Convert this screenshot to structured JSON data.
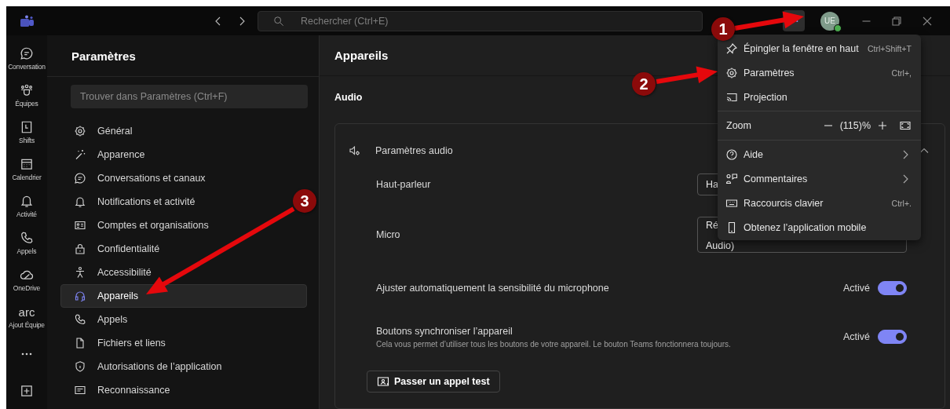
{
  "titlebar": {
    "search": {
      "placeholder": "Rechercher (Ctrl+E)"
    },
    "avatar": {
      "initials": "UE"
    }
  },
  "rail": [
    {
      "kind": "app",
      "label": "Conversation"
    },
    {
      "kind": "app",
      "label": "Équipes"
    },
    {
      "kind": "app",
      "label": "Shifts"
    },
    {
      "kind": "app",
      "label": "Calendrier"
    },
    {
      "kind": "app",
      "label": "Activité"
    },
    {
      "kind": "app",
      "label": "Appels"
    },
    {
      "kind": "app",
      "label": "OneDrive"
    },
    {
      "kind": "text",
      "mark": "arc",
      "label": "Ajout Équipe"
    },
    {
      "kind": "more"
    },
    {
      "kind": "add"
    }
  ],
  "settings": {
    "title": "Paramètres",
    "search": {
      "placeholder": "Trouver dans Paramètres (Ctrl+F)"
    },
    "items": [
      {
        "label": "Général",
        "selected": false
      },
      {
        "label": "Apparence",
        "selected": false
      },
      {
        "label": "Conversations et canaux",
        "selected": false
      },
      {
        "label": "Notifications et activité",
        "selected": false
      },
      {
        "label": "Comptes et organisations",
        "selected": false
      },
      {
        "label": "Confidentialité",
        "selected": false
      },
      {
        "label": "Accessibilité",
        "selected": false
      },
      {
        "label": "Appareils",
        "selected": true
      },
      {
        "label": "Appels",
        "selected": false
      },
      {
        "label": "Fichiers et liens",
        "selected": false
      },
      {
        "label": "Autorisations de l’application",
        "selected": false
      },
      {
        "label": "Reconnaissance",
        "selected": false
      }
    ]
  },
  "main": {
    "title": "Appareils",
    "section": "Audio",
    "card": {
      "title": "Paramètres audio",
      "expanded": true,
      "rows": [
        {
          "kind": "dropdown",
          "label": "Haut-parleur",
          "value": [
            "Ha"
          ]
        },
        {
          "kind": "dropdown",
          "label": "Micro",
          "value": [
            "Ré",
            "Audio)"
          ]
        },
        {
          "kind": "toggle",
          "label": "Ajuster automatiquement la sensibilité du microphone",
          "state_label": "Activé",
          "on": true
        },
        {
          "kind": "toggle",
          "label": "Boutons synchroniser l’appareil",
          "description": "Cela vous permet d’utiliser tous les boutons de votre appareil. Le bouton Teams fonctionnera toujours.",
          "state_label": "Activé",
          "on": true
        }
      ],
      "button": "Passer un appel test"
    }
  },
  "menu": {
    "items": [
      {
        "kind": "item",
        "label": "Épingler la fenêtre en haut",
        "shortcut": "Ctrl+Shift+T"
      },
      {
        "kind": "item",
        "label": "Paramètres",
        "shortcut": "Ctrl+,"
      },
      {
        "kind": "item",
        "label": "Projection"
      },
      {
        "kind": "divider"
      },
      {
        "kind": "zoom",
        "label": "Zoom",
        "value": "(115)%"
      },
      {
        "kind": "divider"
      },
      {
        "kind": "submenu",
        "label": "Aide"
      },
      {
        "kind": "submenu",
        "label": "Commentaires"
      },
      {
        "kind": "item",
        "label": "Raccourcis clavier",
        "shortcut": "Ctrl+."
      },
      {
        "kind": "item",
        "label": "Obtenez l’application mobile"
      }
    ]
  },
  "annotations": [
    {
      "label": "1"
    },
    {
      "label": "2"
    },
    {
      "label": "3"
    }
  ]
}
